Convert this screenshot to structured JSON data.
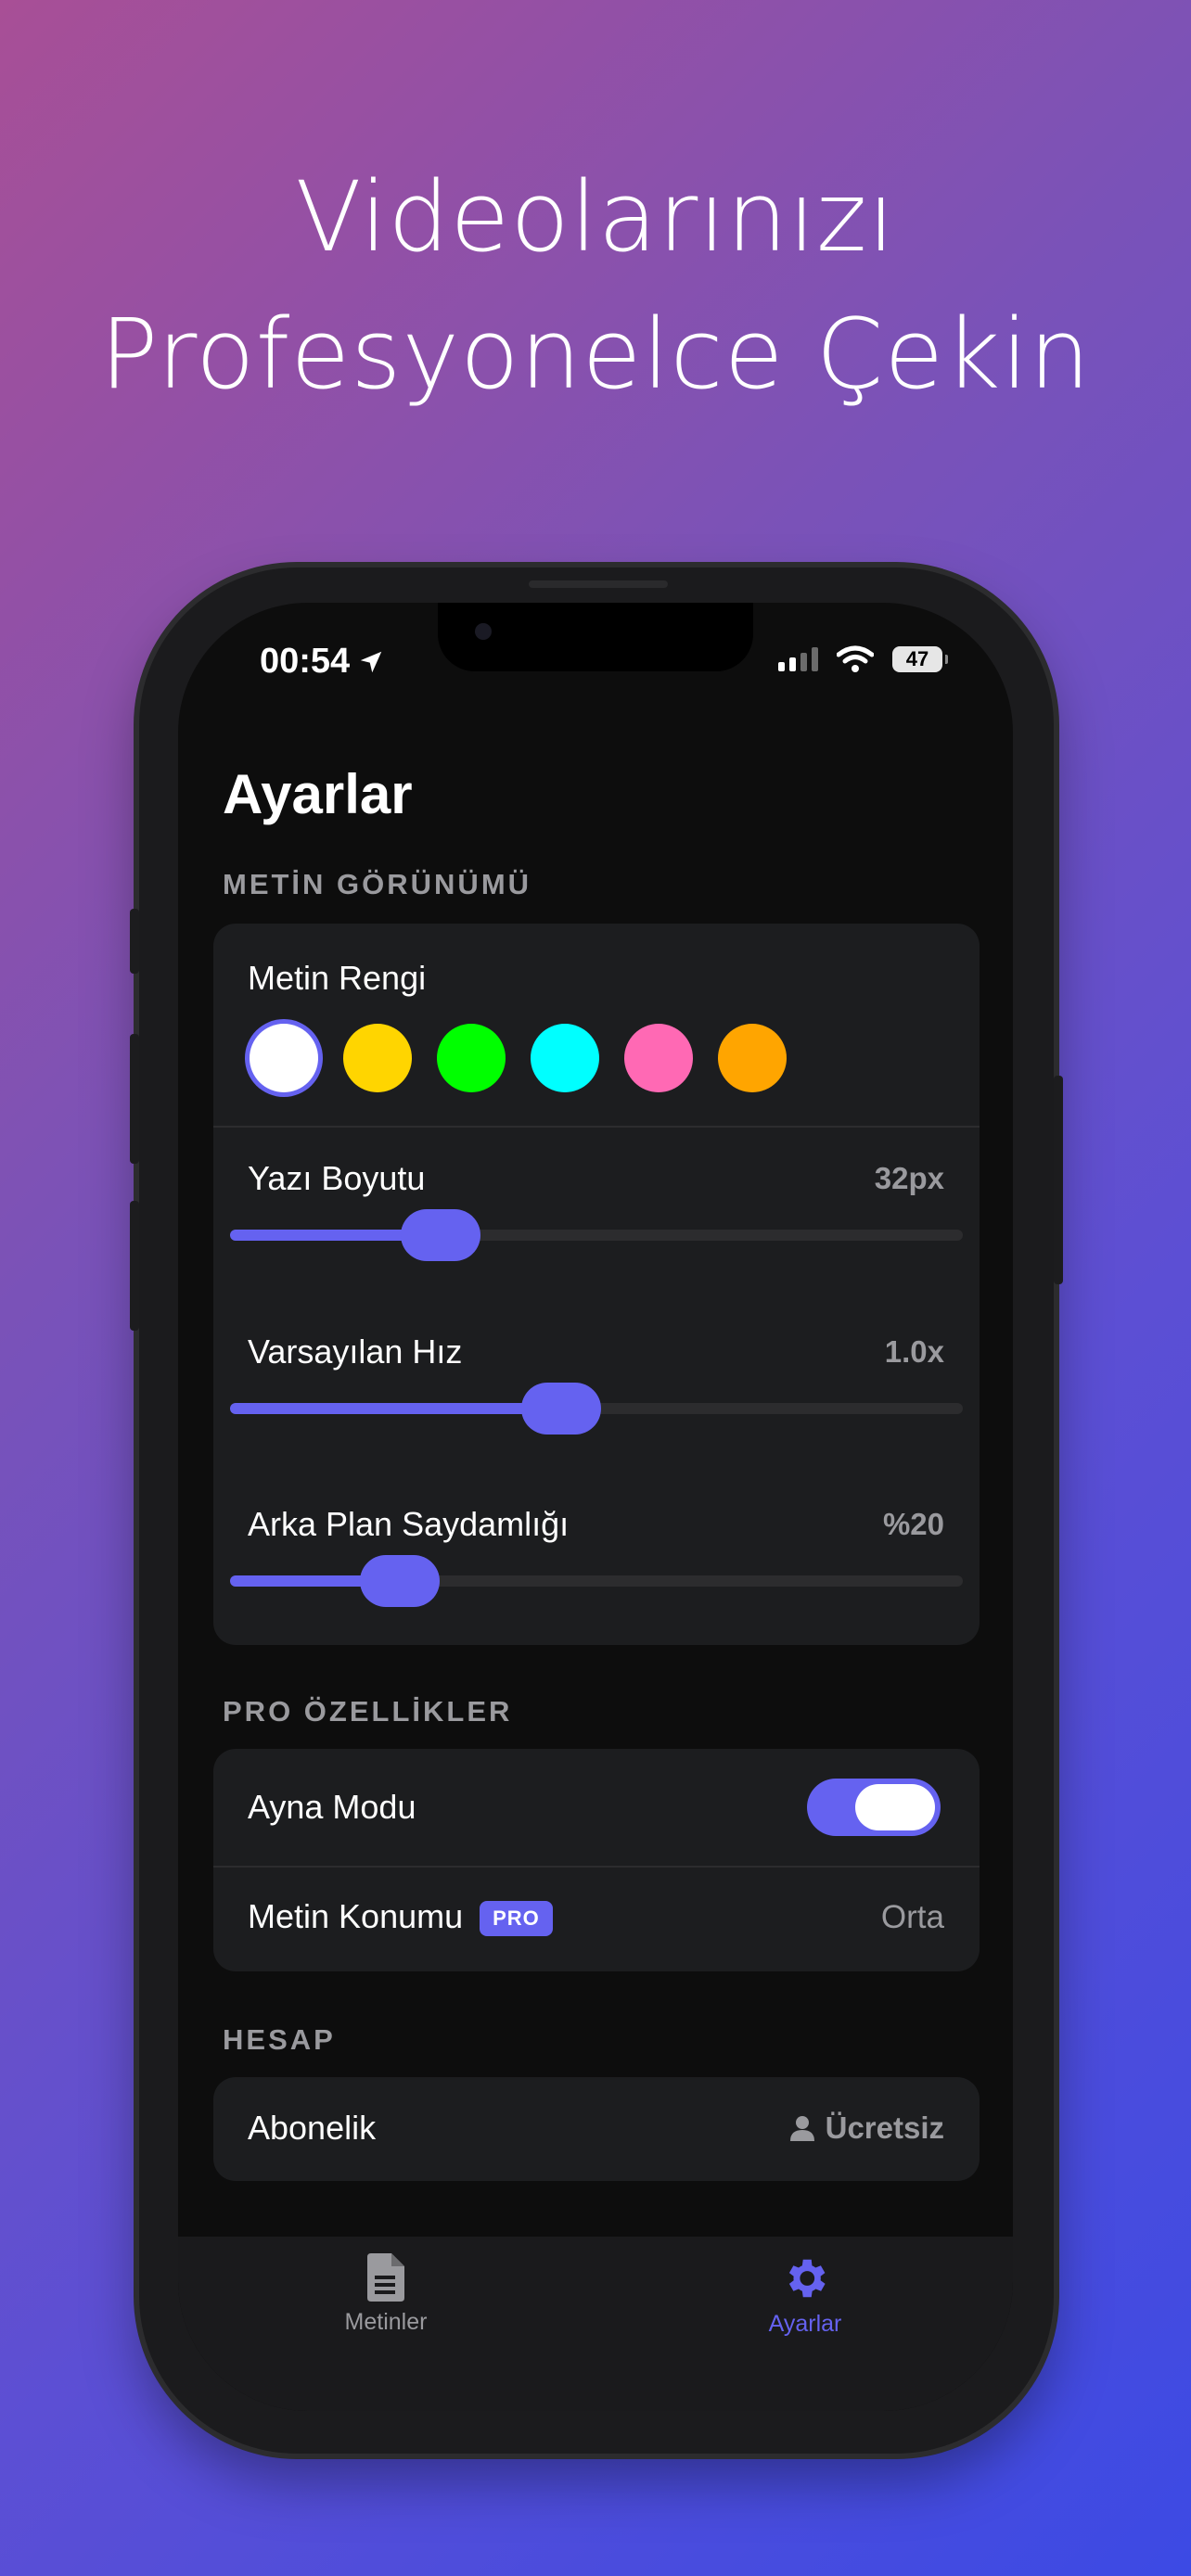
{
  "headline": {
    "line1": "Videolarınızı",
    "line2": "Profesyonelce Çekin"
  },
  "status_bar": {
    "time": "00:54",
    "battery": "47"
  },
  "page_title": "Ayarlar",
  "text_appearance": {
    "section_label": "METİN GÖRÜNÜMÜ",
    "color_label": "Metin Rengi",
    "colors": [
      "#ffffff",
      "#ffd500",
      "#00ff00",
      "#00ffff",
      "#ff69b4",
      "#ffa500"
    ],
    "selected_color": "#ffffff",
    "font_size": {
      "label": "Yazı Boyutu",
      "value": "32px",
      "level": 0.29
    },
    "default_speed": {
      "label": "Varsayılan Hız",
      "value": "1.0x",
      "level": 0.45
    },
    "bg_opacity": {
      "label": "Arka Plan Saydamlığı",
      "value": "%20",
      "level": 0.23
    }
  },
  "pro_features": {
    "section_label": "PRO ÖZELLİKLER",
    "mirror_mode": {
      "label": "Ayna Modu",
      "enabled": true
    },
    "text_position": {
      "label": "Metin Konumu",
      "badge": "PRO",
      "value": "Orta"
    }
  },
  "account": {
    "section_label": "HESAP",
    "subscription": {
      "label": "Abonelik",
      "value": "Ücretsiz"
    }
  },
  "tabs": [
    {
      "label": "Metinler",
      "icon": "document-icon",
      "active": false
    },
    {
      "label": "Ayarlar",
      "icon": "gear-icon",
      "active": true
    }
  ],
  "colors": {
    "accent": "#6562f0",
    "card": "#1c1d1f",
    "background": "#0d0d0d"
  }
}
